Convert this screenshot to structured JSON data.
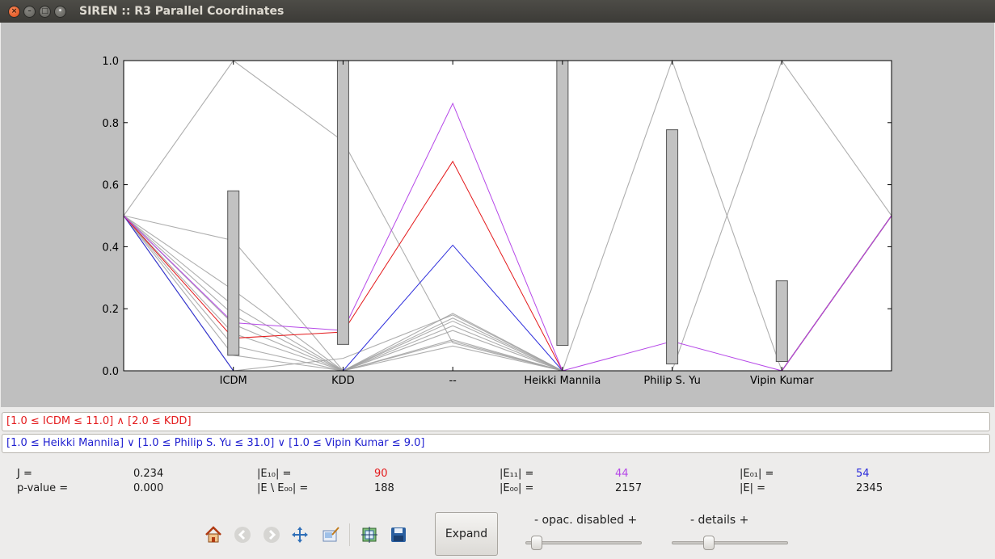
{
  "window": {
    "title": "SIREN :: R3 Parallel Coordinates",
    "close_glyph": "×",
    "minimize_glyph": "–",
    "maximize_glyph": "□",
    "menu_glyph": "•"
  },
  "chart_data": {
    "type": "parallel-coordinates",
    "axes": [
      "ICDM",
      "KDD",
      "--",
      "Heikki Mannila",
      "Philip S. Yu",
      "Vipin Kumar"
    ],
    "ylim": [
      0.0,
      1.0
    ],
    "yticks": [
      "0.0",
      "0.2",
      "0.4",
      "0.6",
      "0.8",
      "1.0"
    ],
    "colors": {
      "grey": "#a0a0a0",
      "red": "#e41a1c",
      "violet": "#b648e8",
      "blue": "#2b2bdb",
      "box": "#c2c2c2"
    },
    "boxes": [
      {
        "axis": "ICDM",
        "low": 0.05,
        "high": 0.58
      },
      {
        "axis": "KDD",
        "low": 0.085,
        "high": 1.0
      },
      {
        "axis": "Heikki Mannila",
        "low": 0.082,
        "high": 1.0
      },
      {
        "axis": "Philip S. Yu",
        "low": 0.022,
        "high": 0.777
      },
      {
        "axis": "Vipin Kumar",
        "low": 0.03,
        "high": 0.29
      }
    ],
    "lines": [
      {
        "color": "grey",
        "values": [
          0.5,
          1.0,
          0.74,
          0.09,
          0.0,
          0.0,
          0.0,
          0.5
        ]
      },
      {
        "color": "grey",
        "values": [
          0.5,
          0.42,
          0.0,
          0.0,
          0.0,
          1.0,
          0.0,
          0.5
        ]
      },
      {
        "color": "grey",
        "values": [
          0.5,
          0.0,
          0.04,
          0.18,
          0.0,
          0.0,
          1.0,
          0.5
        ]
      },
      {
        "color": "grey",
        "values": [
          0.5,
          0.26,
          0.0,
          0.185,
          0.0,
          0.0,
          0.0,
          0.5
        ]
      },
      {
        "color": "grey",
        "values": [
          0.5,
          0.21,
          0.0,
          0.17,
          0.0,
          0.0,
          0.0,
          0.5
        ]
      },
      {
        "color": "grey",
        "values": [
          0.5,
          0.18,
          0.0,
          0.16,
          0.0,
          0.0,
          0.0,
          0.5
        ]
      },
      {
        "color": "grey",
        "values": [
          0.5,
          0.15,
          0.0,
          0.145,
          0.0,
          0.0,
          0.0,
          0.5
        ]
      },
      {
        "color": "grey",
        "values": [
          0.5,
          0.12,
          0.0,
          0.13,
          0.0,
          0.0,
          0.0,
          0.5
        ]
      },
      {
        "color": "grey",
        "values": [
          0.5,
          0.08,
          0.0,
          0.1,
          0.0,
          0.0,
          0.0,
          0.5
        ]
      },
      {
        "color": "grey",
        "values": [
          0.5,
          0.05,
          0.0,
          0.095,
          0.0,
          0.0,
          0.0,
          0.5
        ]
      },
      {
        "color": "grey",
        "values": [
          0.5,
          0.0,
          0.0,
          0.08,
          0.0,
          0.0,
          0.0,
          0.5
        ]
      },
      {
        "color": "blue",
        "values": [
          0.5,
          0.0,
          0.0,
          0.405,
          0.0,
          0.0,
          0.0,
          0.5
        ]
      },
      {
        "color": "red",
        "values": [
          0.5,
          0.105,
          0.125,
          0.675,
          0.0,
          0.0,
          0.0,
          0.5
        ]
      },
      {
        "color": "violet",
        "values": [
          0.5,
          0.155,
          0.13,
          0.862,
          0.0,
          0.095,
          0.0,
          0.5
        ]
      }
    ]
  },
  "rules": {
    "left_rule": "[1.0 ≤ ICDM ≤ 11.0] ∧  [2.0 ≤ KDD]",
    "right_rule": "[1.0 ≤ Heikki Mannila] ∨  [1.0 ≤ Philip S. Yu ≤ 31.0] ∨  [1.0 ≤ Vipin Kumar ≤ 9.0]"
  },
  "stats": {
    "j_label": "J =",
    "j_value": "0.234",
    "pvalue_label": "p-value =",
    "pvalue_value": "0.000",
    "e10_label": "|E₁₀| =",
    "e10_value": "90",
    "e_minus_e00_label": "|E \\ E₀₀| =",
    "e_minus_e00_value": "188",
    "e11_label": "|E₁₁| =",
    "e11_value": "44",
    "e00_label": "|E₀₀| =",
    "e00_value": "2157",
    "e01_label": "|E₀₁| =",
    "e01_value": "54",
    "e_label": "|E| =",
    "e_value": "2345",
    "e10_color": "#e41a1c",
    "e11_color": "#b648e8",
    "e01_color": "#2b2bdb"
  },
  "toolbar": {
    "icons": [
      "home-icon",
      "back-icon",
      "forward-icon",
      "pan-icon",
      "zoom-icon",
      "configure-subplots-icon",
      "save-icon"
    ],
    "expand_label": "Expand",
    "opacity_label": "- opac. disabled  +",
    "details_label": "-    details    +",
    "opacity_level": 0.05,
    "details_level": 0.3
  }
}
